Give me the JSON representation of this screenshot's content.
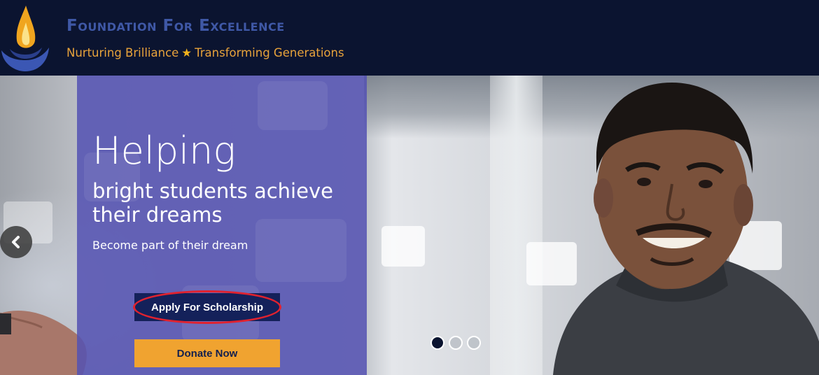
{
  "brand": {
    "title": "Foundation For Excellence",
    "tagline_left": "Nurturing Brilliance",
    "tagline_right": "Transforming Generations",
    "logo": "flame-lamp-logo",
    "colors": {
      "header_bg": "#0b1430",
      "title": "#3f58a6",
      "tagline": "#e8a33b"
    }
  },
  "hero": {
    "heading": "Helping",
    "subheading": "bright students achieve their dreams",
    "tagline": "Become part of their dream",
    "apply_label": "Apply For Scholarship",
    "donate_label": "Donate Now",
    "panel_color": "#5452b2",
    "apply_color": "#14215a",
    "donate_color": "#f0a330",
    "highlight_color": "#e0222f"
  },
  "carousel": {
    "prev_icon": "chevron-left-icon",
    "slides": 3,
    "active_slide": 1
  }
}
